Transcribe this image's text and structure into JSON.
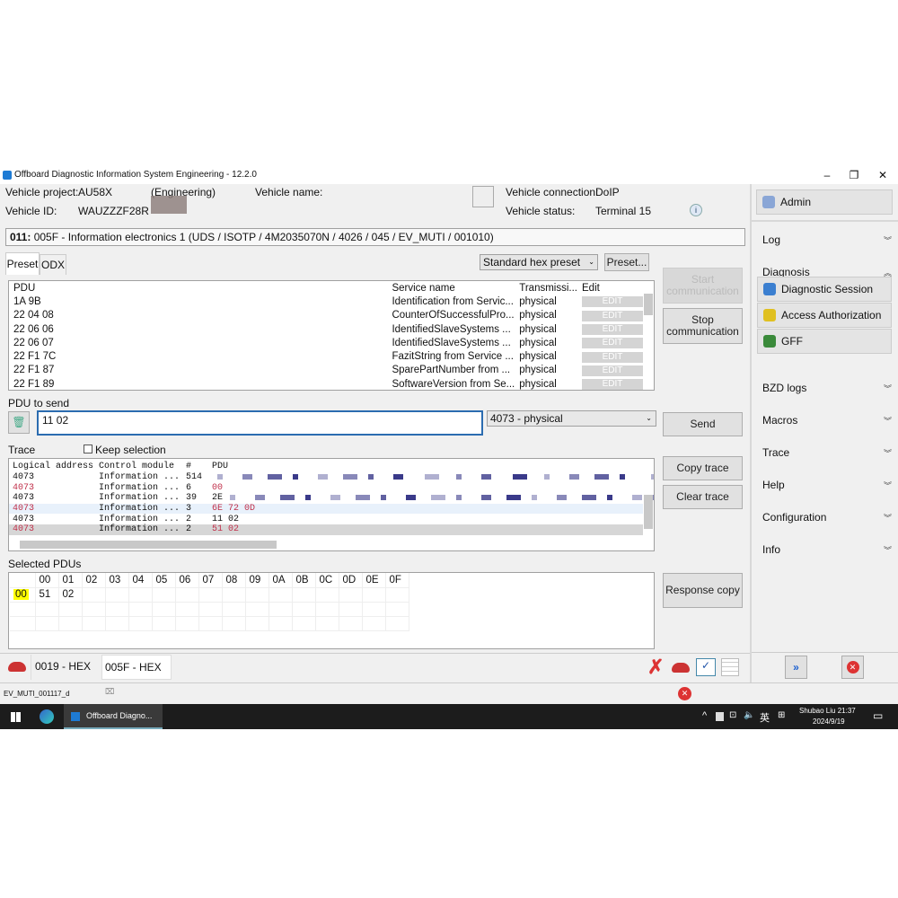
{
  "window": {
    "title": "Offboard Diagnostic Information System Engineering - 12.2.0",
    "minimize": "–",
    "restore": "❐",
    "close": "✕"
  },
  "vehicle": {
    "project_label": "Vehicle project:",
    "project": "AU58X",
    "mode": "(Engineering)",
    "name_label": "Vehicle name:",
    "id_label": "Vehicle ID:",
    "id": "WAUZZZF28R",
    "connection_label": "Vehicle connection:",
    "connection": "DoIP",
    "status_label": "Vehicle status:",
    "status": "Terminal 15"
  },
  "ecu": {
    "code": "011:",
    "desc": "005F - Information electronics 1  (UDS / ISOTP / 4M2035070N / 4026 / 045 / EV_MUTI / 001010)"
  },
  "tabs": [
    "Preset",
    "ODX"
  ],
  "preset": {
    "selected": "Standard hex preset",
    "button": "Preset..."
  },
  "pdu_table": {
    "headers": [
      "PDU",
      "Service name",
      "Transmissi...",
      "Edit"
    ],
    "edit_label": "EDIT",
    "rows": [
      [
        "1A 9B",
        "Identification from Servic...",
        "physical"
      ],
      [
        "22 04 08",
        "CounterOfSuccessfulPro...",
        "physical"
      ],
      [
        "22 06 06",
        "IdentifiedSlaveSystems ...",
        "physical"
      ],
      [
        "22 06 07",
        "IdentifiedSlaveSystems ...",
        "physical"
      ],
      [
        "22 F1 7C",
        "FazitString from Service ...",
        "physical"
      ],
      [
        "22 F1 87",
        "SparePartNumber from ...",
        "physical"
      ],
      [
        "22 F1 89",
        "SoftwareVersion from Se...",
        "physical"
      ]
    ]
  },
  "buttons": {
    "start": "Start communication",
    "stop": "Stop communication",
    "send": "Send",
    "copy_trace": "Copy trace",
    "clear_trace": "Clear trace",
    "response_copy": "Response copy"
  },
  "send": {
    "label": "PDU to send",
    "value": "11 02",
    "target": "4073 - physical"
  },
  "trace": {
    "label": "Trace",
    "keep_selection": "Keep selection",
    "keep_checked": false,
    "headers": [
      "Logical address",
      "Control module",
      "#",
      "PDU"
    ],
    "rows": [
      {
        "addr": "4073",
        "module": "Information ...",
        "n": "514",
        "pdu": "",
        "dir": "tx"
      },
      {
        "addr": "4073",
        "module": "Information ...",
        "n": "6",
        "pdu": "00",
        "dir": "rx"
      },
      {
        "addr": "4073",
        "module": "Information ...",
        "n": "39",
        "pdu": "2E",
        "dir": "tx"
      },
      {
        "addr": "4073",
        "module": "Information ...",
        "n": "3",
        "pdu": "6E 72 0D",
        "dir": "rx"
      },
      {
        "addr": "4073",
        "module": "Information ...",
        "n": "2",
        "pdu": "11 02",
        "dir": "tx"
      },
      {
        "addr": "4073",
        "module": "Information ...",
        "n": "2",
        "pdu": "51 02",
        "dir": "rx"
      }
    ]
  },
  "selected": {
    "label": "Selected PDUs",
    "columns": [
      "00",
      "01",
      "02",
      "03",
      "04",
      "05",
      "06",
      "07",
      "08",
      "09",
      "0A",
      "0B",
      "0C",
      "0D",
      "0E",
      "0F"
    ],
    "row_label": "00",
    "values": [
      "51",
      "02"
    ]
  },
  "bottom_tabs": [
    "0019 - HEX",
    "005F - HEX"
  ],
  "status_text": "EV_MUTI_001117_d",
  "sidebar": {
    "admin": "Admin",
    "sections": [
      {
        "label": "Log",
        "expanded": false
      },
      {
        "label": "Diagnosis",
        "expanded": true,
        "items": [
          "Diagnostic Session",
          "Access Authorization",
          "GFF"
        ]
      },
      {
        "label": "BZD logs",
        "expanded": false
      },
      {
        "label": "Macros",
        "expanded": false
      },
      {
        "label": "Trace",
        "expanded": false
      },
      {
        "label": "Help",
        "expanded": false
      },
      {
        "label": "Configuration",
        "expanded": false
      },
      {
        "label": "Info",
        "expanded": false
      }
    ]
  },
  "taskbar": {
    "app": "Offboard Diagno...",
    "ime": "英",
    "user_time": "Shubao Liu 21:37",
    "date": "2024/9/19"
  },
  "colors": {
    "accent": "#1e7bd4",
    "highlight": "#ffff00",
    "rx": "#c0304a"
  }
}
